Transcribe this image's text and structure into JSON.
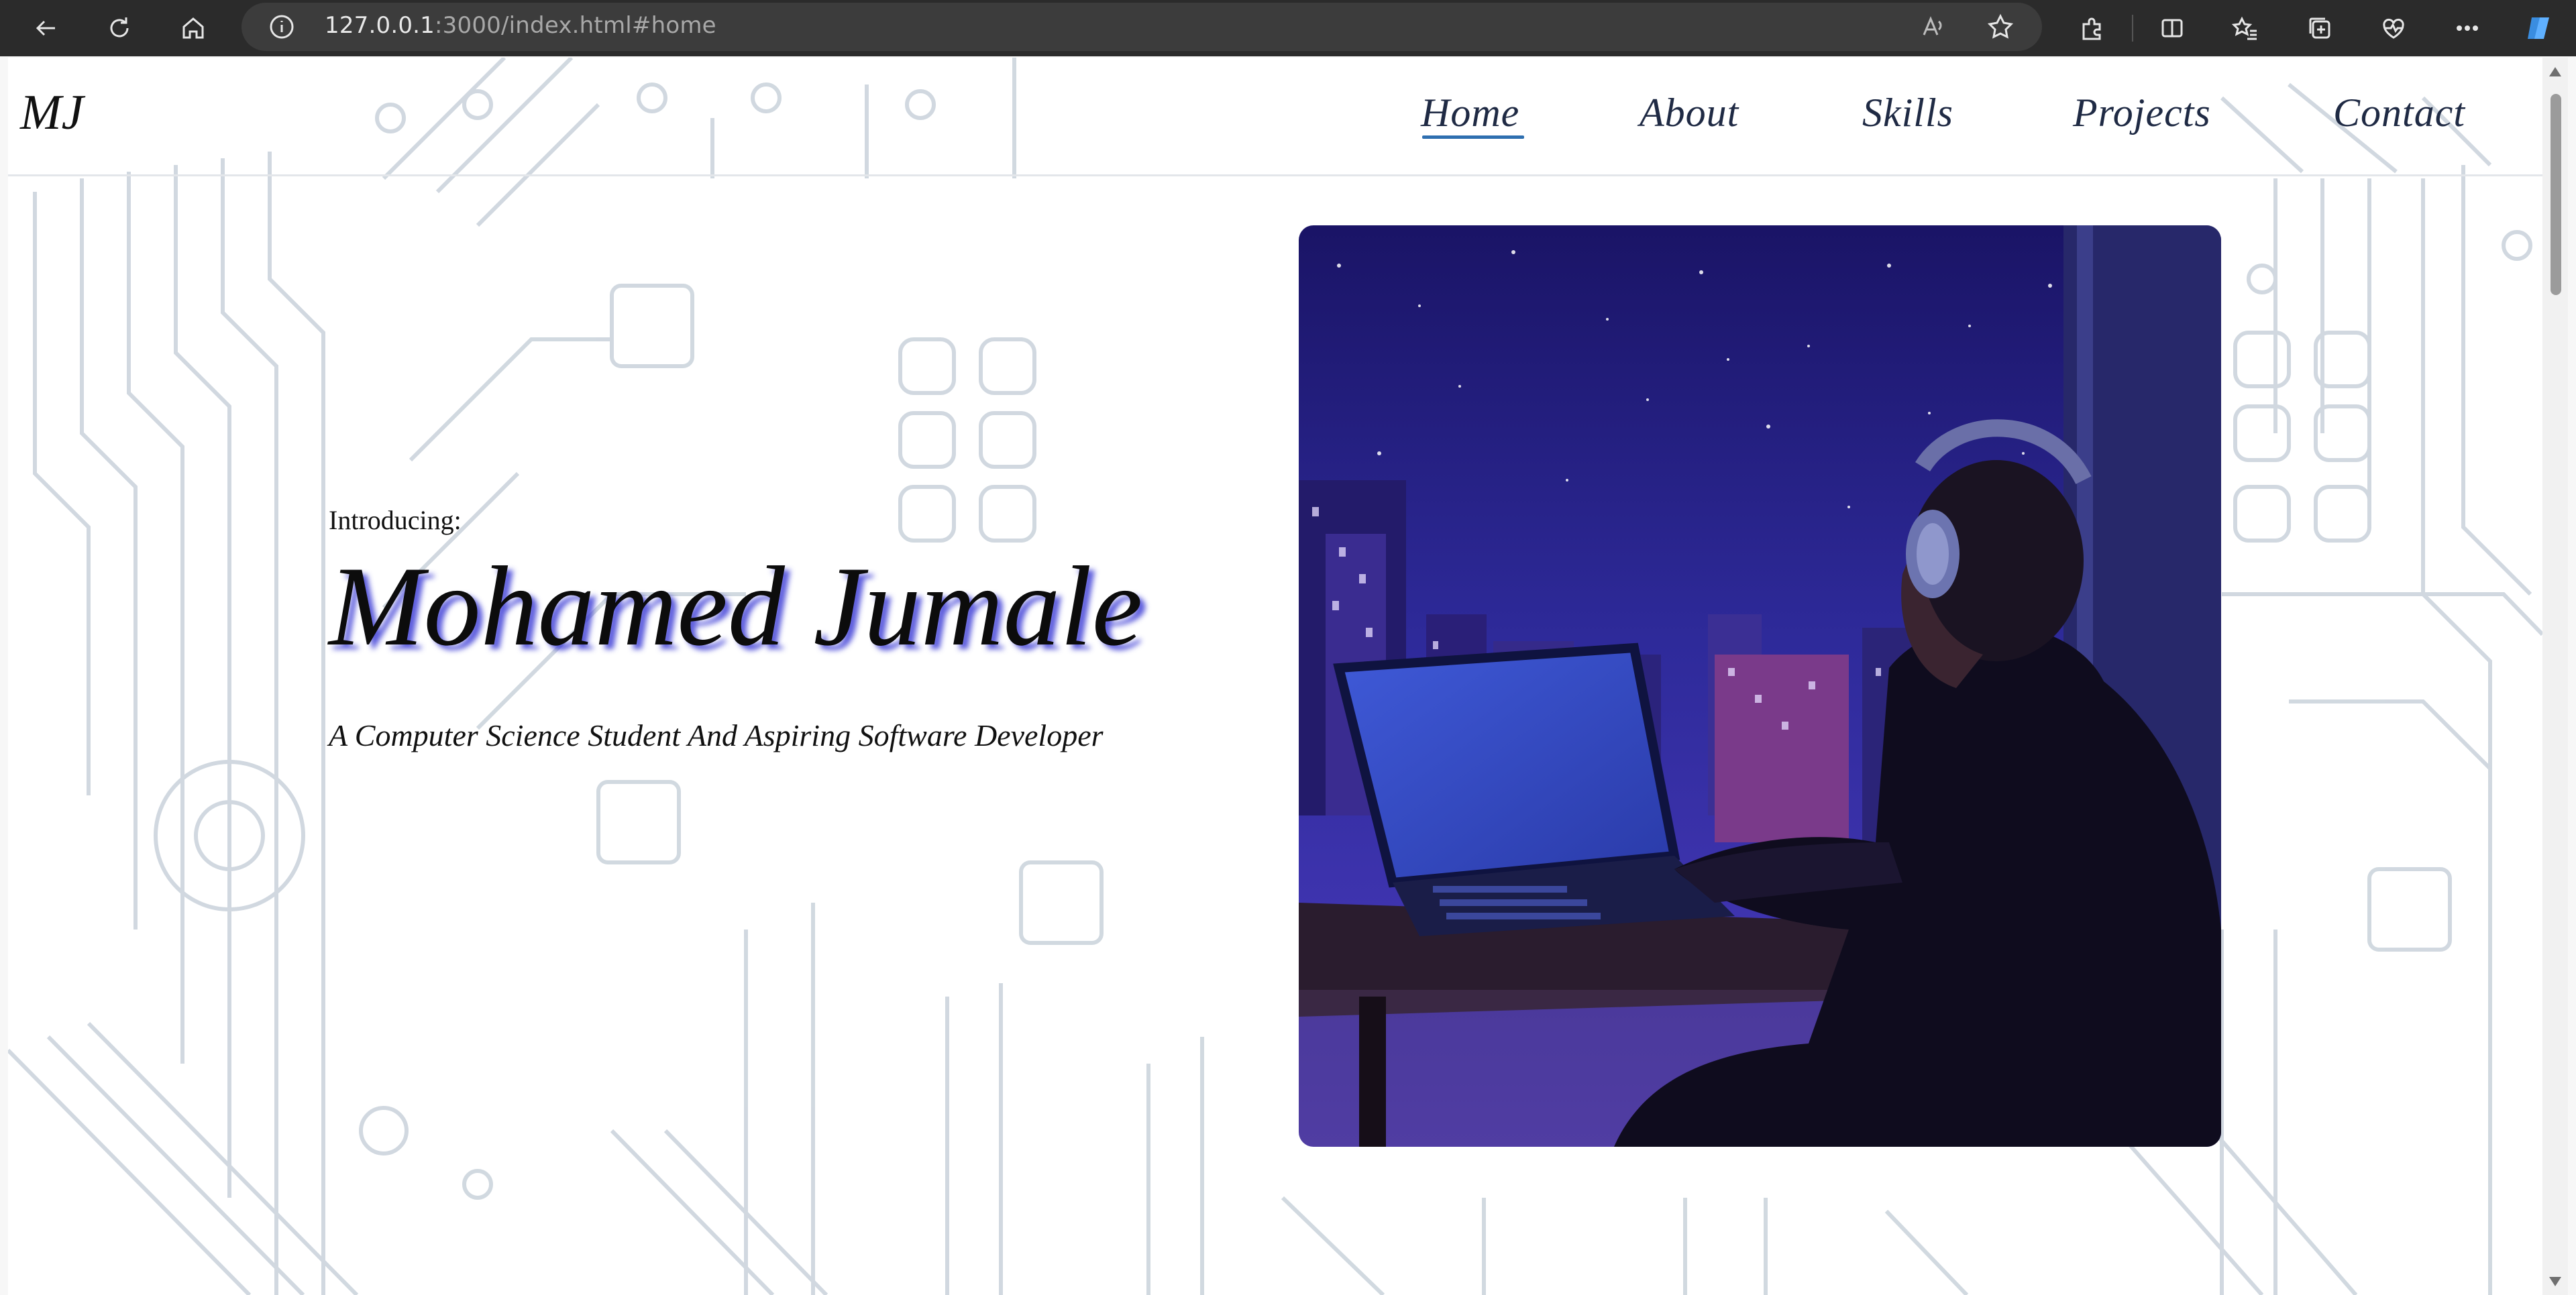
{
  "browser": {
    "url_host": "127.0.0.1",
    "url_rest": ":3000/index.html#home",
    "icons": [
      "back-icon",
      "refresh-icon",
      "home-icon",
      "info-icon",
      "read-aloud-icon",
      "favorite-star-icon",
      "extensions-icon",
      "split-screen-icon",
      "favorites-icon",
      "collections-icon",
      "browser-essentials-icon",
      "more-icon",
      "copilot-icon"
    ]
  },
  "site": {
    "logo": "MJ",
    "nav": [
      {
        "label": "Home",
        "active": true
      },
      {
        "label": "About"
      },
      {
        "label": "Skills"
      },
      {
        "label": "Projects"
      },
      {
        "label": "Contact"
      }
    ]
  },
  "hero": {
    "intro": "Introducing:",
    "name": "Mohamed Jumale",
    "subtitle": "A Computer Science Student And Aspiring Software Developer",
    "image_subject": "person with headphones using a laptop at night overlooking city skyline"
  },
  "colors": {
    "accent_underline": "#2e6fb0",
    "name_shadow": "#2828d2",
    "circuit_lines": "#c9d2db"
  }
}
